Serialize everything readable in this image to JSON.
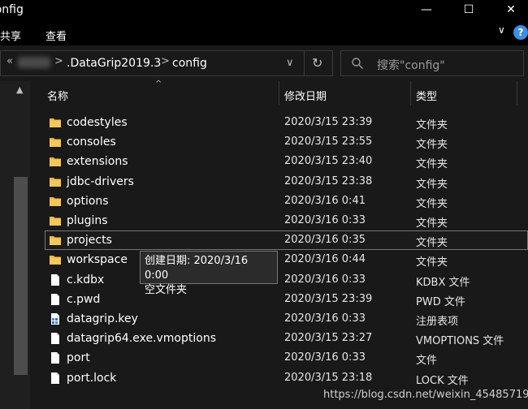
{
  "window": {
    "title": "config",
    "minimize_glyph": "—",
    "maximize_glyph": "☐",
    "close_glyph": "✕"
  },
  "ribbon": {
    "items": [
      "共享",
      "查看"
    ],
    "collapse_glyph": "∨",
    "help_glyph": "?"
  },
  "address": {
    "back_glyph": "«",
    "crumbs": [
      ".DataGrip2019.3",
      "config"
    ],
    "separator_glyph": ">",
    "dropdown_glyph": "∨",
    "refresh_glyph": "↻"
  },
  "search": {
    "placeholder": "搜索\"config\""
  },
  "columns": {
    "name": "名称",
    "date": "修改日期",
    "type": "类型"
  },
  "files": [
    {
      "name": "codestyles",
      "date": "2020/3/15 23:39",
      "type": "文件夹",
      "icon": "folder-icon"
    },
    {
      "name": "consoles",
      "date": "2020/3/15 23:55",
      "type": "文件夹",
      "icon": "folder-icon"
    },
    {
      "name": "extensions",
      "date": "2020/3/15 23:40",
      "type": "文件夹",
      "icon": "folder-icon"
    },
    {
      "name": "jdbc-drivers",
      "date": "2020/3/15 23:38",
      "type": "文件夹",
      "icon": "folder-icon"
    },
    {
      "name": "options",
      "date": "2020/3/16 0:41",
      "type": "文件夹",
      "icon": "folder-icon"
    },
    {
      "name": "plugins",
      "date": "2020/3/16 0:33",
      "type": "文件夹",
      "icon": "folder-icon"
    },
    {
      "name": "projects",
      "date": "2020/3/16 0:35",
      "type": "文件夹",
      "icon": "folder-icon",
      "selected": true
    },
    {
      "name": "workspace",
      "date": "2020/3/16 0:44",
      "type": "文件夹",
      "icon": "folder-icon"
    },
    {
      "name": "c.kdbx",
      "date": "2020/3/16 0:33",
      "type": "KDBX 文件",
      "icon": "file-icon"
    },
    {
      "name": "c.pwd",
      "date": "2020/3/15 23:39",
      "type": "PWD 文件",
      "icon": "file-icon"
    },
    {
      "name": "datagrip.key",
      "date": "2020/3/16 0:33",
      "type": "注册表项",
      "icon": "registry-file-icon"
    },
    {
      "name": "datagrip64.exe.vmoptions",
      "date": "2020/3/15 23:27",
      "type": "VMOPTIONS 文件",
      "icon": "file-icon"
    },
    {
      "name": "port",
      "date": "2020/3/16 0:33",
      "type": "文件",
      "icon": "file-icon"
    },
    {
      "name": "port.lock",
      "date": "2020/3/15 23:18",
      "type": "LOCK 文件",
      "icon": "file-icon"
    }
  ],
  "tooltip": {
    "line1": "创建日期: 2020/3/16 0:00",
    "line2": "空文件夹"
  },
  "watermark": "https://blog.csdn.net/weixin_45485719",
  "colors": {
    "background": "#191919",
    "folder": "#e8b84a",
    "accent_help": "#3a8ee6"
  }
}
